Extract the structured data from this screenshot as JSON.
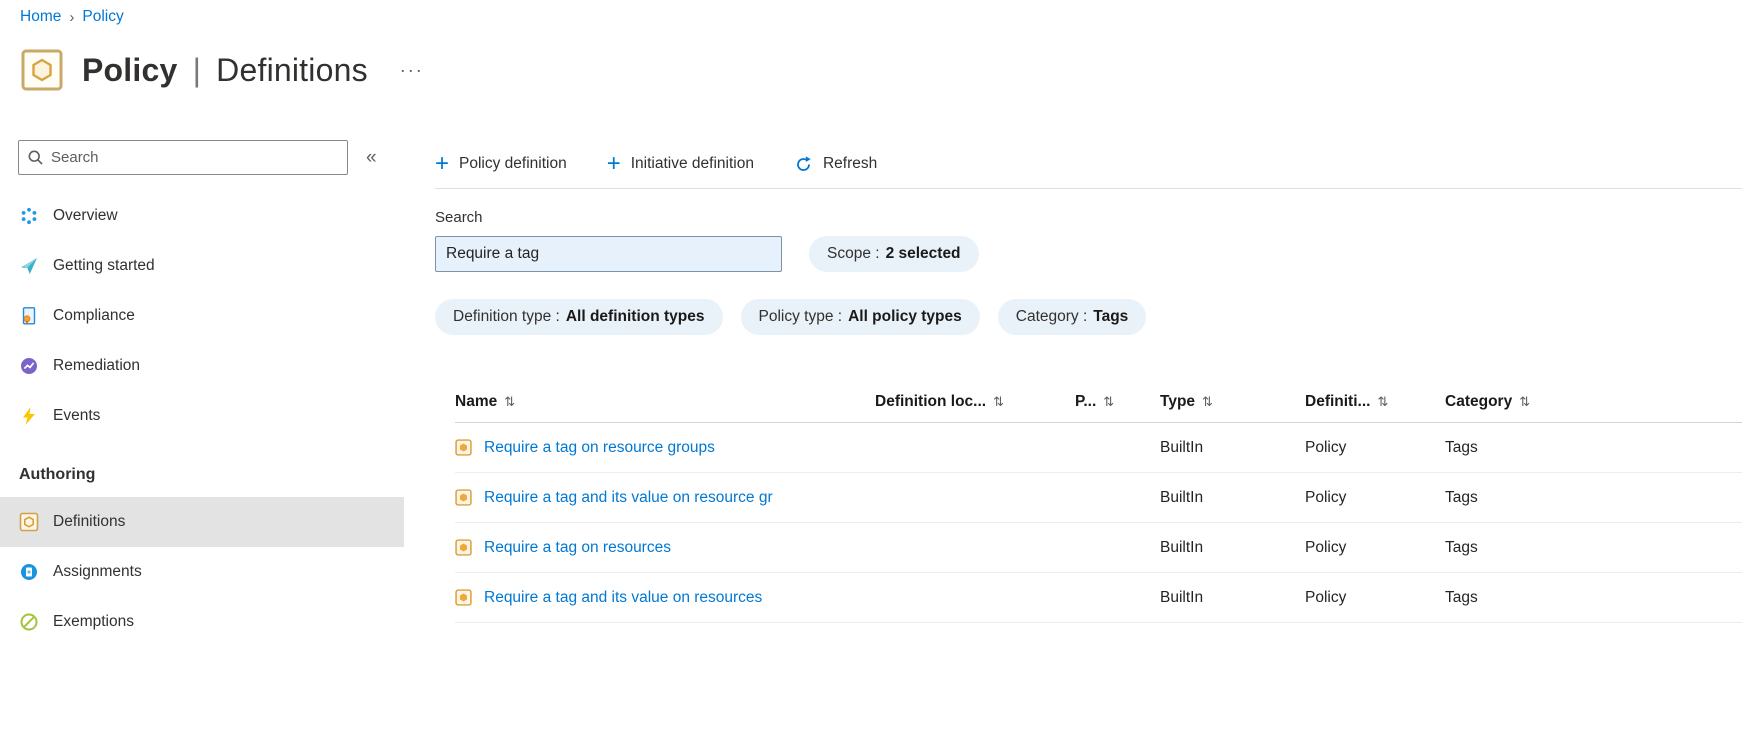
{
  "breadcrumb": {
    "home": "Home",
    "chevron_icon": "›",
    "current": "Policy"
  },
  "header": {
    "title_primary": "Policy",
    "title_separator": "|",
    "title_secondary": "Definitions",
    "more_icon": "···"
  },
  "sidebar": {
    "search_placeholder": "Search",
    "collapse_icon": "«",
    "items": [
      {
        "label": "Overview"
      },
      {
        "label": "Getting started"
      },
      {
        "label": "Compliance"
      },
      {
        "label": "Remediation"
      },
      {
        "label": "Events"
      }
    ],
    "section_label": "Authoring",
    "authoring_items": [
      {
        "label": "Definitions"
      },
      {
        "label": "Assignments"
      },
      {
        "label": "Exemptions"
      }
    ]
  },
  "toolbar": {
    "plus_icon": "+",
    "policy_definition_label": "Policy definition",
    "initiative_definition_label": "Initiative definition",
    "refresh_label": "Refresh"
  },
  "filters": {
    "search_label": "Search",
    "search_value": "Require a tag",
    "scope_pill": {
      "label": "Scope :",
      "value": "2 selected"
    },
    "pills": [
      {
        "label": "Definition type :",
        "value": "All definition types"
      },
      {
        "label": "Policy type :",
        "value": "All policy types"
      },
      {
        "label": "Category :",
        "value": "Tags"
      }
    ]
  },
  "table": {
    "sort_icon": "⇅",
    "columns": [
      {
        "label": "Name"
      },
      {
        "label": "Definition loc..."
      },
      {
        "label": "P..."
      },
      {
        "label": "Type"
      },
      {
        "label": "Definiti..."
      },
      {
        "label": "Category"
      }
    ],
    "rows": [
      {
        "name": "Require a tag on resource groups",
        "definition_location": "",
        "p": "",
        "type": "BuiltIn",
        "definition_type": "Policy",
        "category": "Tags"
      },
      {
        "name": "Require a tag and its value on resource gr",
        "definition_location": "",
        "p": "",
        "type": "BuiltIn",
        "definition_type": "Policy",
        "category": "Tags"
      },
      {
        "name": "Require a tag on resources",
        "definition_location": "",
        "p": "",
        "type": "BuiltIn",
        "definition_type": "Policy",
        "category": "Tags"
      },
      {
        "name": "Require a tag and its value on resources",
        "definition_location": "",
        "p": "",
        "type": "BuiltIn",
        "definition_type": "Policy",
        "category": "Tags"
      }
    ]
  }
}
